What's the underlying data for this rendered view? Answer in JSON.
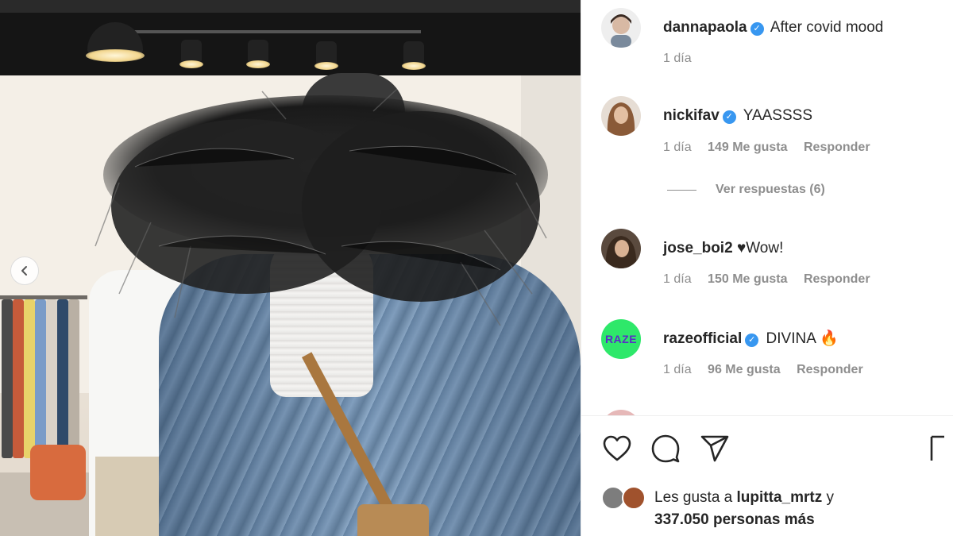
{
  "post": {
    "author": "dannapaola",
    "caption": "After covid mood",
    "time": "1 día"
  },
  "comments": [
    {
      "user": "nickifav",
      "verified": true,
      "text": "YAASSSS",
      "time": "1 día",
      "likes": "149 Me gusta",
      "reply_label": "Responder",
      "avatar_color": "#c9a98d"
    },
    {
      "user": "jose_boi2",
      "verified": false,
      "text": "♥Wow!",
      "time": "1 día",
      "likes": "150 Me gusta",
      "reply_label": "Responder",
      "avatar_color": "#8a6a52"
    },
    {
      "user": "razeofficial",
      "verified": true,
      "text": "DIVINA 🔥",
      "time": "1 día",
      "likes": "96 Me gusta",
      "reply_label": "Responder",
      "avatar_color": "#2ee86a",
      "avatar_text": "RAZE"
    }
  ],
  "view_replies": "Ver respuestas (6)",
  "liked_by": {
    "prefix": "Les gusta a",
    "user": "lupitta_mrtz",
    "joiner": "y",
    "count": "337.050 personas más"
  },
  "icons": {
    "verified": "verified-badge-icon",
    "like": "heart-icon",
    "comment": "comment-bubble-icon",
    "share": "paper-plane-icon",
    "prev": "chevron-left-icon"
  },
  "colors": {
    "verified": "#3897f0",
    "muted_text": "#8e8e8e",
    "raze_brand": "#2ee86a"
  }
}
